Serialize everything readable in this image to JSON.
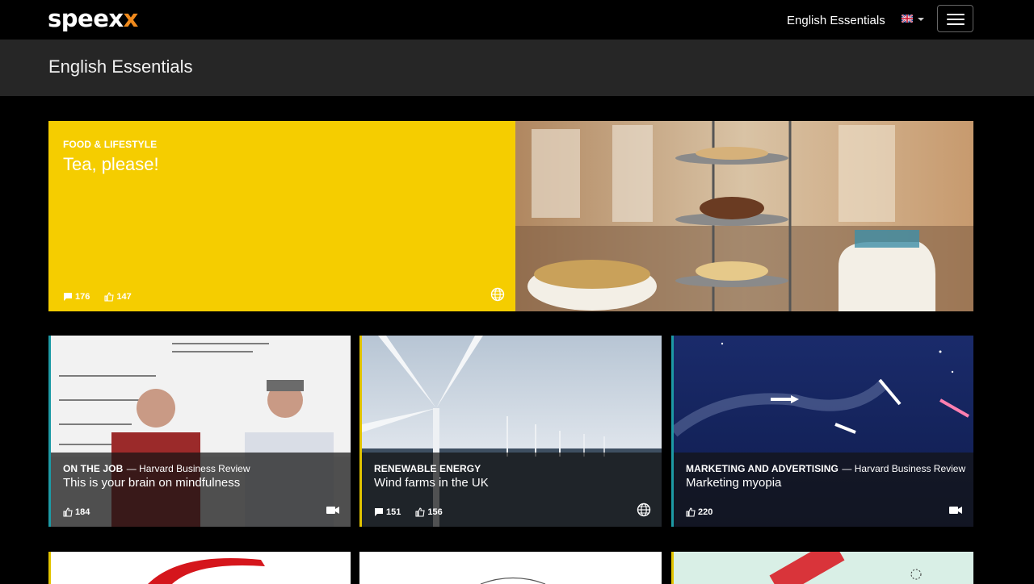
{
  "brand": {
    "name_part1": "speex",
    "name_part2": "x"
  },
  "topbar": {
    "course_link": "English Essentials",
    "language_flag": "uk-flag-icon",
    "menu_icon": "hamburger-menu-icon"
  },
  "header": {
    "title": "English Essentials"
  },
  "featured": {
    "category": "FOOD & LIFESTYLE",
    "title": "Tea, please!",
    "comments": "176",
    "likes": "147",
    "type_icon": "globe-icon",
    "accent": "#f5cd00"
  },
  "tiles": [
    {
      "category": "ON THE JOB",
      "source": "— Harvard Business Review",
      "title": "This is your brain on mindfulness",
      "likes": "184",
      "type_icon": "video-camera-icon",
      "accent": "#1d9aa5"
    },
    {
      "category": "RENEWABLE ENERGY",
      "source": "",
      "title": "Wind farms in the UK",
      "comments": "151",
      "likes": "156",
      "type_icon": "globe-icon",
      "accent": "#e2c400"
    },
    {
      "category": "MARKETING AND ADVERTISING",
      "source": "— Harvard Business Review",
      "title": "Marketing myopia",
      "likes": "220",
      "type_icon": "video-camera-icon",
      "accent": "#1d9aa5"
    }
  ]
}
